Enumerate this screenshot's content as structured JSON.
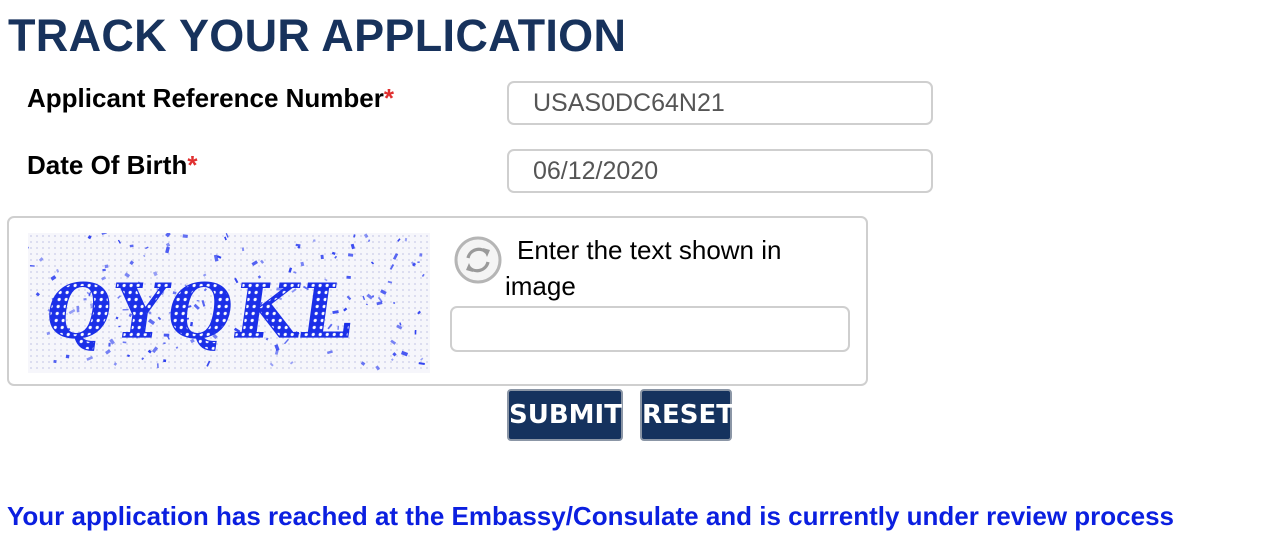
{
  "page": {
    "title": "TRACK YOUR APPLICATION"
  },
  "form": {
    "reference_label": "Applicant Reference Number",
    "reference_value": "USAS0DC64N21",
    "dob_label": "Date Of Birth",
    "dob_value": "06/12/2020",
    "required_marker": "*"
  },
  "captcha": {
    "image_text": "QYQKL",
    "prompt": "Enter the text shown in image",
    "input_value": "",
    "refresh_icon": "refresh-icon"
  },
  "buttons": {
    "submit_label": "SUBMIT",
    "reset_label": "RESET"
  },
  "status": {
    "message": "Your application has reached at the Embassy/Consulate and is currently under review process"
  },
  "colors": {
    "title": "#17325c",
    "button_bg": "#15325e",
    "required": "#e03030",
    "status_text": "#0b1fe0",
    "captcha_text": "#1b2fe8"
  }
}
